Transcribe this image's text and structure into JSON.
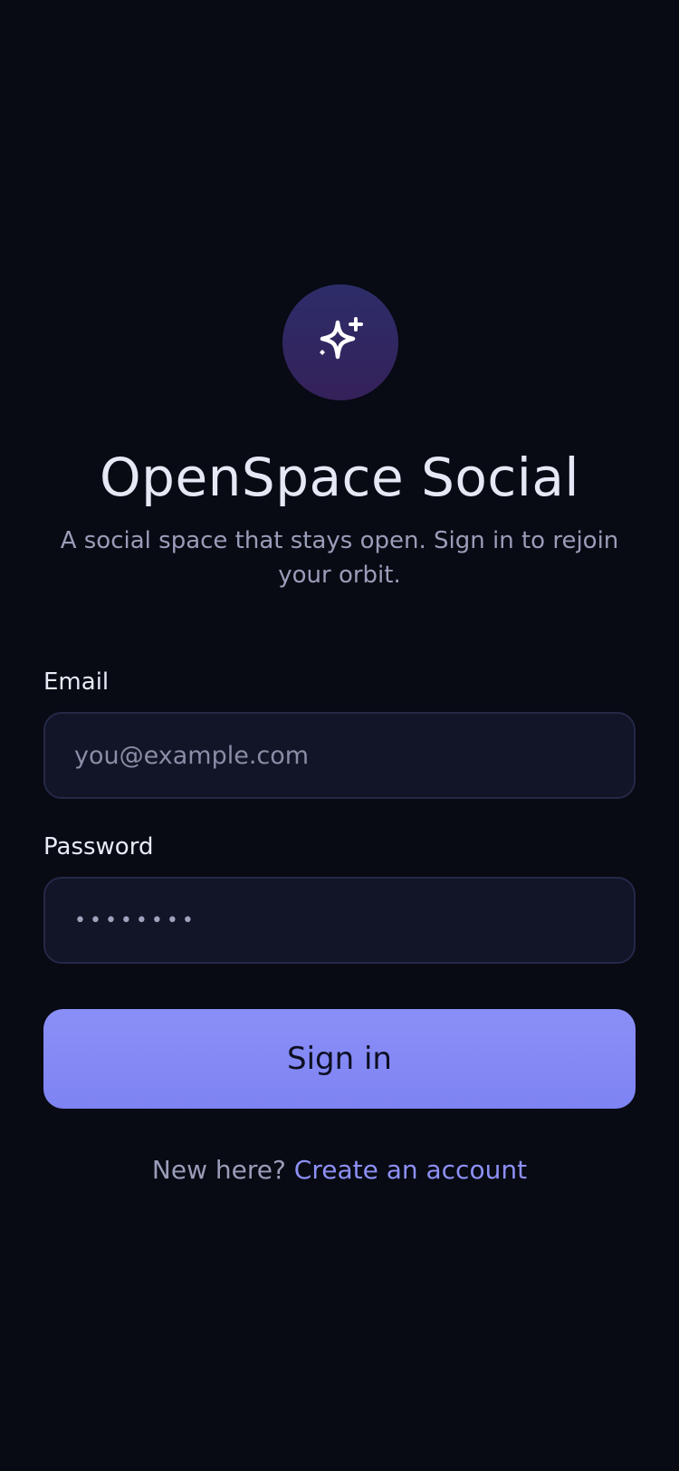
{
  "app": {
    "logo_icon": "sparkles-icon",
    "title": "OpenSpace Social",
    "subtitle": "A social space that stays open. Sign in to rejoin your orbit."
  },
  "form": {
    "email_label": "Email",
    "email_placeholder": "you@example.com",
    "email_value": "",
    "password_label": "Password",
    "password_value": "••••••••",
    "submit_label": "Sign in"
  },
  "footer": {
    "prompt": "New here?",
    "link_label": "Create an account"
  },
  "colors": {
    "background": "#080a14",
    "accent": "#8488f6",
    "field_bg": "#121527",
    "field_border": "#252847"
  }
}
